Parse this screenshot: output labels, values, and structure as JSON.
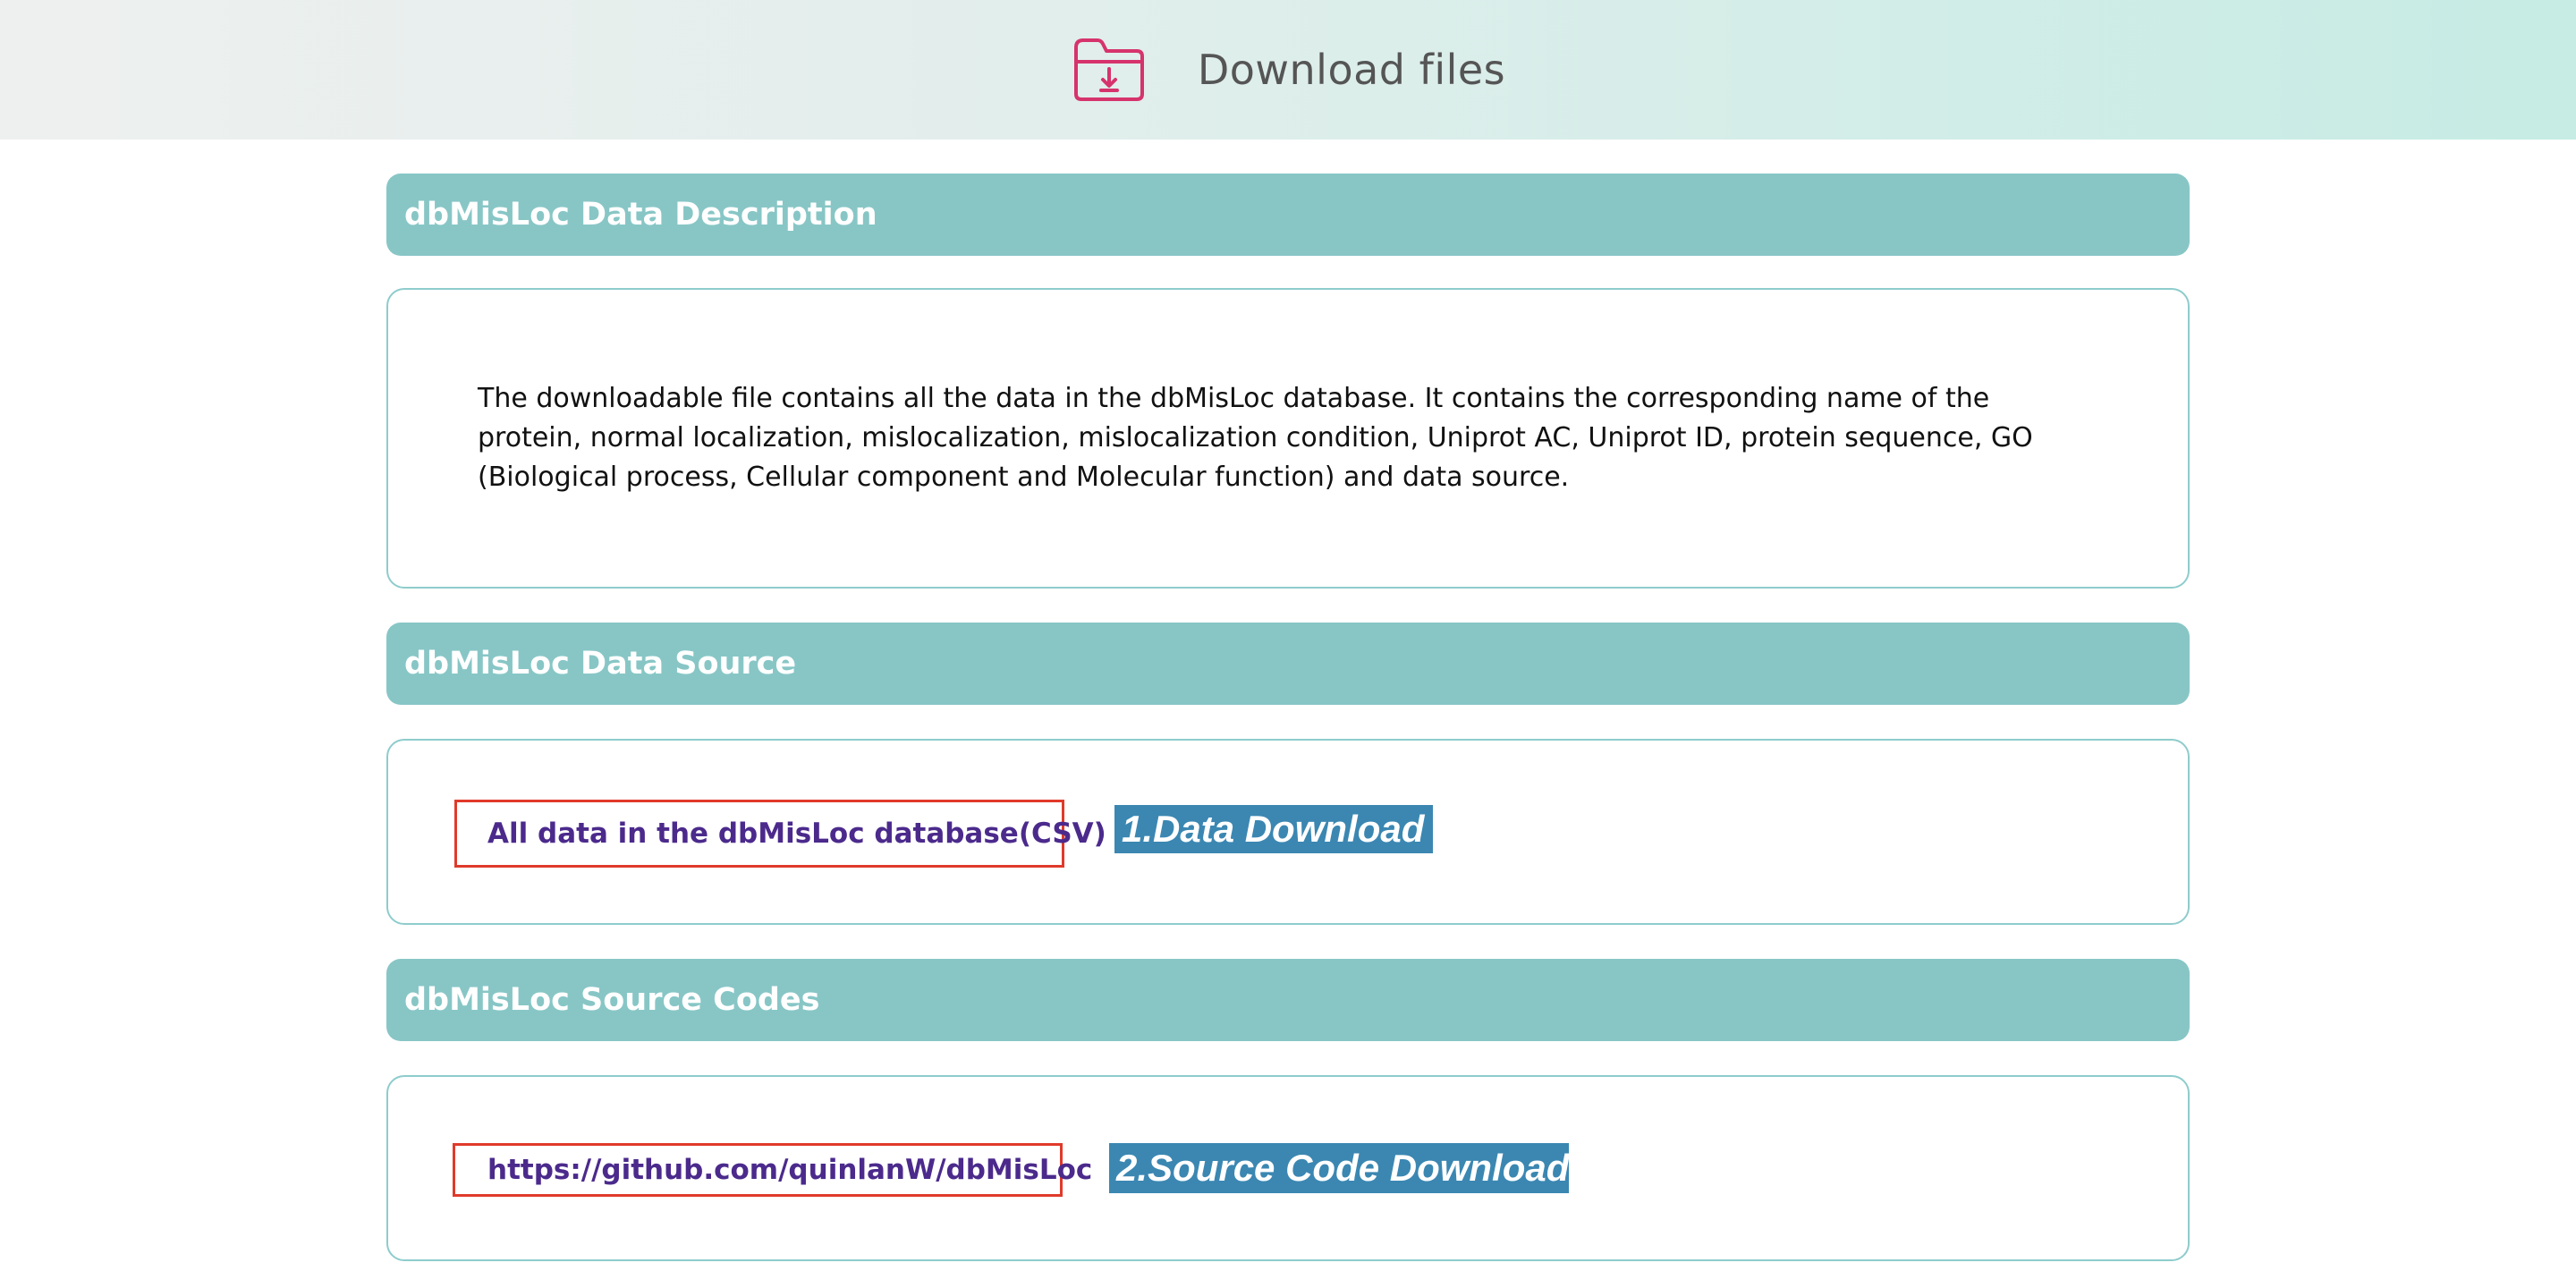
{
  "header": {
    "title": "Download files",
    "icon": "folder-download-icon",
    "icon_color": "#d6336c"
  },
  "sections": {
    "description": {
      "title": "dbMisLoc Data Description",
      "text": "The downloadable file contains all the data in the dbMisLoc database. It contains the corresponding name of the protein, normal localization, mislocalization, mislocalization condition, Uniprot AC, Uniprot ID, protein sequence, GO (Biological process, Cellular component and Molecular function) and data source."
    },
    "data_source": {
      "title": "dbMisLoc Data Source",
      "link_label": "All data in the dbMisLoc database(CSV)",
      "link_icon": "csv-file-download-icon",
      "annotation": "1.Data Download"
    },
    "source_codes": {
      "title": "dbMisLoc Source Codes",
      "link_label": "https://github.com/quinlanW/dbMisLoc",
      "link_icon": "github-icon",
      "annotation": "2.Source Code Download"
    }
  },
  "colors": {
    "header_bar": "#88c6c6",
    "panel_border": "#8fcccc",
    "link": "#4b2a8c",
    "highlight_box": "#e03a2a",
    "annotation_bg": "#3b87b2"
  }
}
